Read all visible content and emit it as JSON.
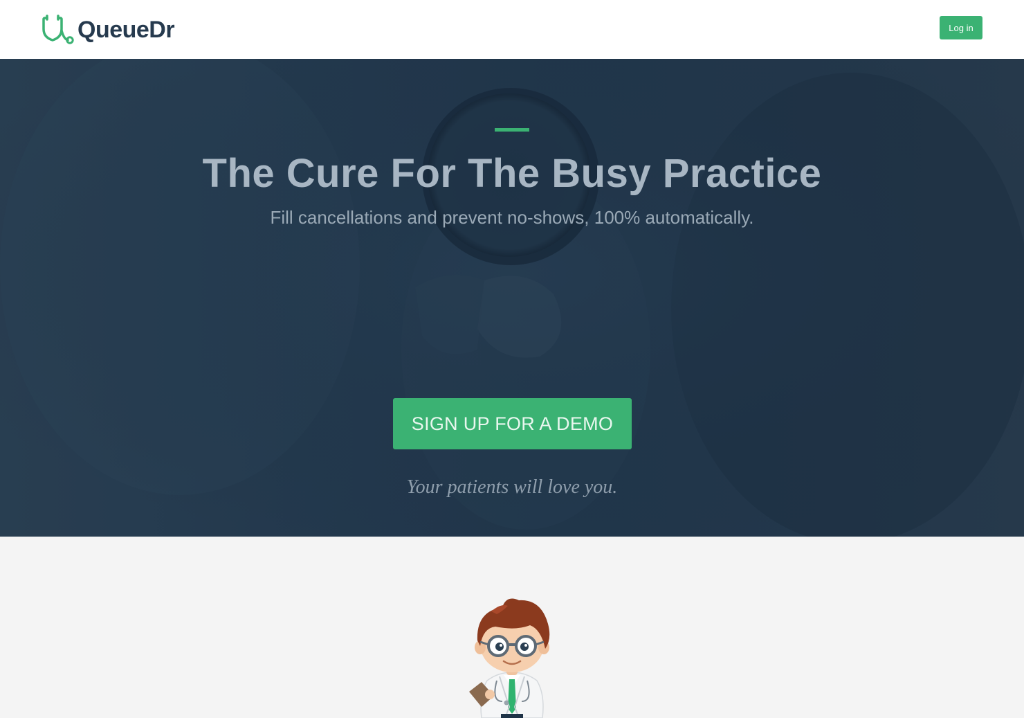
{
  "header": {
    "brand": "QueueDr",
    "logo_icon": "stethoscope-shield-icon",
    "login_label": "Log in"
  },
  "hero": {
    "title": "The Cure For The Busy Practice",
    "subtitle": "Fill cancellations and prevent no-shows, 100% automatically.",
    "cta_label": "SIGN UP FOR A DEMO",
    "tagline": "Your patients will love you."
  },
  "illustration": {
    "name": "doctor-mascot"
  },
  "colors": {
    "accent": "#3bb273",
    "brand_text": "#263a4e",
    "hero_overlay": "#22384d",
    "page_background": "#f4f4f4"
  }
}
